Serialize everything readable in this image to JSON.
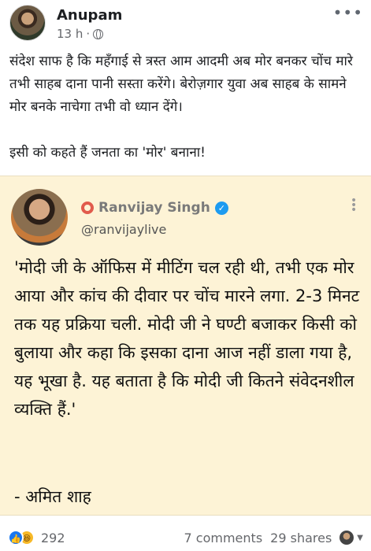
{
  "post": {
    "author": "Anupam",
    "time": "13 h",
    "separator": "·",
    "more": "•••",
    "paragraph1": "संदेश साफ है कि महँगाई से त्रस्त आम आदमी अब मोर बनकर चोंच मारे तभी साहब दाना पानी सस्ता करेंगे। बेरोज़गार युवा अब साहब के सामने मोर बनके नाचेगा तभी वो ध्यान देंगे।",
    "paragraph2": "इसी को कहते हैं जनता का 'मोर' बनाना!"
  },
  "shared_tweet": {
    "name": "Ranvijay Singh",
    "verified_mark": "✓",
    "handle": "@ranvijaylive",
    "text": "'मोदी जी के ऑफिस में मीटिंग चल रही थी, तभी एक मोर आया और कांच की दीवार पर चोंच मारने लगा. 2-3 मिनट तक यह प्रक्रिया चली. मोदी जी ने घण्टी बजाकर किसी को बुलाया और कहा कि इसका दाना आज नहीं डाला गया है, यह भूखा है. यह बताता है कि मोदी जी कितने संवेदनशील व्यक्ति हैं.'",
    "signature": "- अमित शाह",
    "dots": "•\n•\n•"
  },
  "footer": {
    "reaction_count": "292",
    "comments": "7 comments",
    "shares": "29 shares"
  },
  "icons": {
    "like": "like-icon",
    "haha": "haha-icon",
    "globe": "globe-icon",
    "verified": "verified-icon"
  },
  "colors": {
    "card_background": "#fdf3d6",
    "like_blue": "#1877f2",
    "verified_blue": "#1d9bf0"
  }
}
